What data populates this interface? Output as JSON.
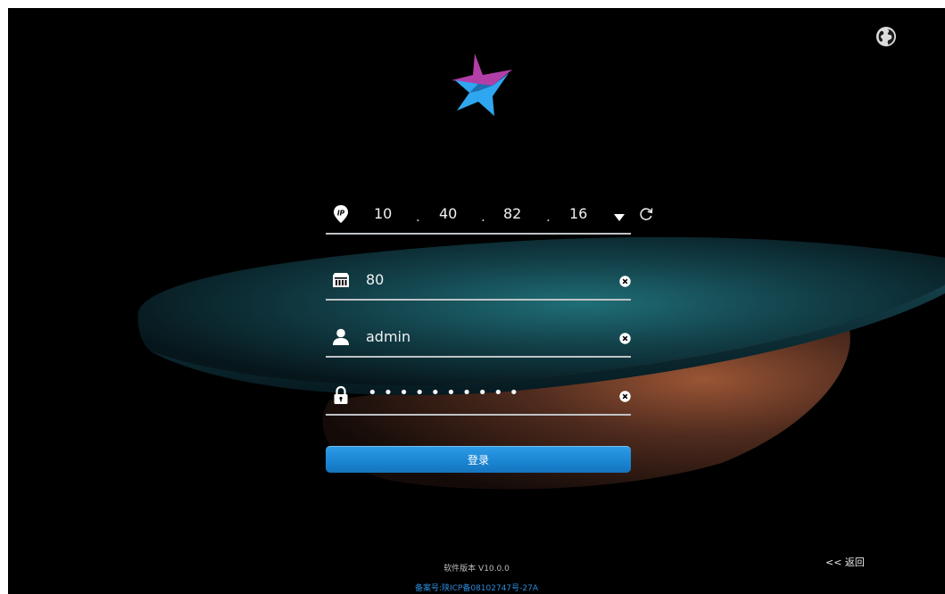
{
  "theme": {
    "accent": "#1b86d4",
    "logo_magenta": "#b23fa8",
    "logo_blue": "#2fa6f0",
    "field_line": "#bfc3c6",
    "link_color": "#2d8ad8"
  },
  "header": {
    "language_icon": "globe-icon",
    "logo_icon": "star-logo"
  },
  "form": {
    "ip": {
      "icon": "ip-location-icon",
      "segments": [
        "10",
        "40",
        "82",
        "16"
      ],
      "separator": ".",
      "dropdown_icon": "caret-down-icon",
      "refresh_icon": "refresh-icon"
    },
    "port": {
      "icon": "port-icon",
      "value": "80",
      "clear_icon": "clear-icon"
    },
    "username": {
      "icon": "user-icon",
      "value": "admin",
      "clear_icon": "clear-icon"
    },
    "password": {
      "icon": "lock-icon",
      "masked": "••••••••••",
      "clear_icon": "clear-icon"
    },
    "login_label": "登录"
  },
  "footer": {
    "back_label": "<< 返回",
    "version": "软件版本 V10.0.0",
    "icp": "备案号:陕ICP备08102747号-27A"
  }
}
